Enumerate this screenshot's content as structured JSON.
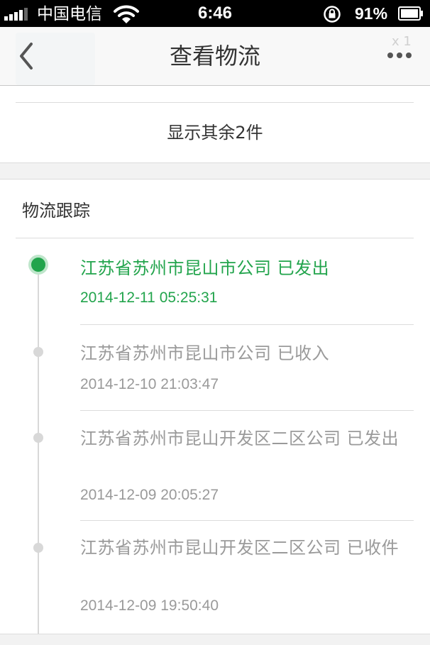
{
  "status_bar": {
    "carrier": "中国电信",
    "time": "6:46",
    "battery": "91%"
  },
  "nav": {
    "title": "查看物流",
    "ghost_badge": "x 1"
  },
  "items": {
    "show_more": "显示其余2件"
  },
  "tracking": {
    "title": "物流跟踪",
    "events": [
      {
        "status": "江苏省苏州市昆山市公司 已发出",
        "time": "2014-12-11 05:25:31",
        "active": true
      },
      {
        "status": "江苏省苏州市昆山市公司 已收入",
        "time": "2014-12-10 21:03:47",
        "active": false
      },
      {
        "status": "江苏省苏州市昆山开发区二区公司 已发出",
        "time": "2014-12-09 20:05:27",
        "active": false
      },
      {
        "status": "江苏省苏州市昆山开发区二区公司 已收件",
        "time": "2014-12-09 19:50:40",
        "active": false
      }
    ]
  },
  "colors": {
    "accent": "#22a44c",
    "muted": "#9a9a9a"
  },
  "icons": [
    "signal-icon",
    "wifi-icon",
    "rotation-lock-icon",
    "battery-icon",
    "back-chevron-icon",
    "more-dots-icon"
  ]
}
